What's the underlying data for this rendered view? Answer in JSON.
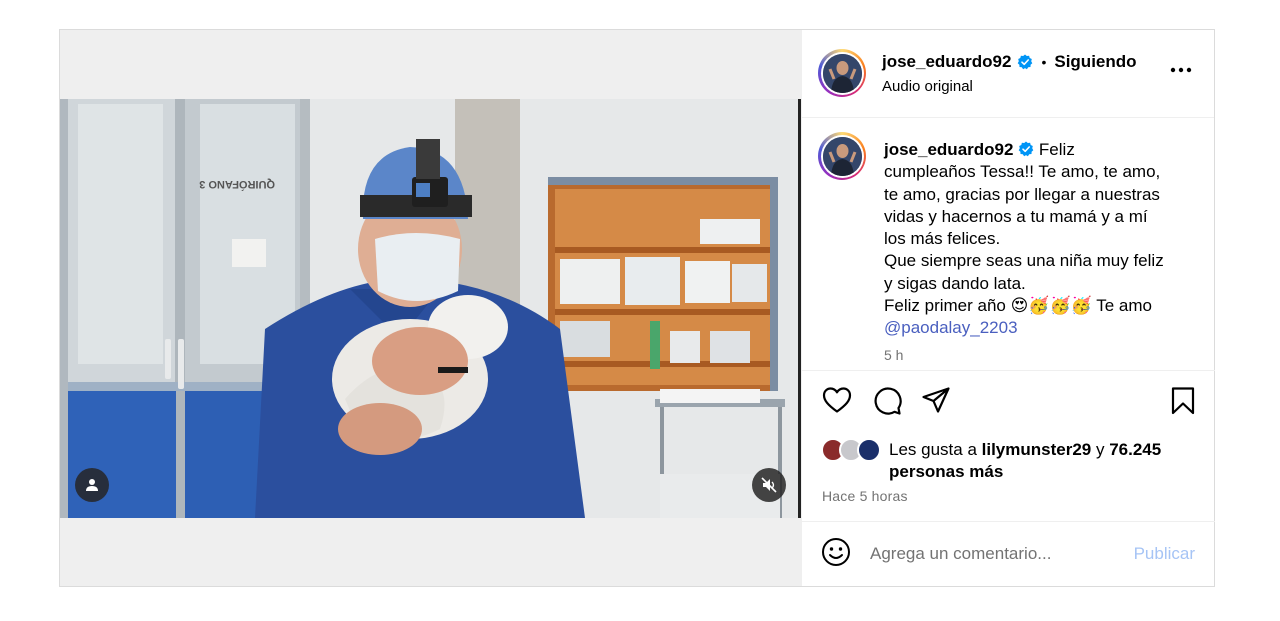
{
  "post": {
    "author": {
      "username": "jose_eduardo92",
      "verified": true,
      "follow_status": "Siguiendo",
      "audio": "Audio original"
    },
    "caption": {
      "username": "jose_eduardo92",
      "lines": [
        "Feliz",
        "cumpleaños Tessa!! Te amo, te amo,",
        "te amo, gracias por llegar a nuestras",
        "vidas y hacernos a tu mamá y a mí",
        "los más felices.",
        "Que siempre seas una niña muy feliz",
        "y sigas dando lata.",
        "Feliz primer año 😍🥳🥳🥳 Te amo"
      ],
      "mention": "@paodalay_2203",
      "time": "5 h"
    },
    "likes": {
      "prefix": "Les gusta a",
      "user": "lilymunster29",
      "connector": "y",
      "count_text": "76.245 personas más"
    },
    "posted_ago": "Hace 5 horas",
    "comment": {
      "placeholder": "Agrega un comentario...",
      "publish_label": "Publicar"
    },
    "video": {
      "sign_text": "QUIRÓFANO 3"
    },
    "icons": {
      "verified": "verified-badge-icon",
      "more": "more-options-icon",
      "like": "heart-icon",
      "comment": "comment-icon",
      "share": "share-icon",
      "save": "bookmark-icon",
      "emoji": "emoji-icon",
      "user_tag": "user-icon",
      "mute": "muted-speaker-icon"
    },
    "colors": {
      "verified_blue": "#0095f6",
      "link": "#4a5fbf",
      "secondary_text": "#737373",
      "border": "#dbdbdb"
    }
  }
}
